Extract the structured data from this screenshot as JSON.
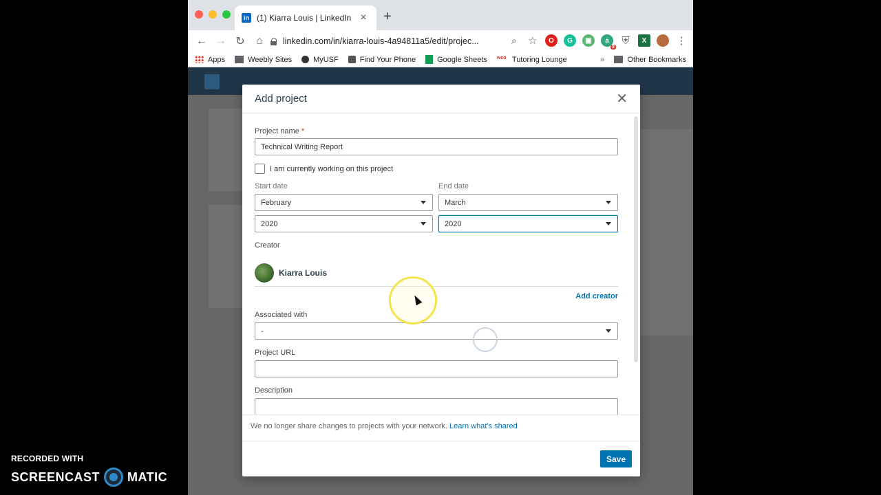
{
  "watermark": {
    "line1": "RECORDED WITH",
    "left": "SCREENCAST",
    "right": "MATIC"
  },
  "browser": {
    "tab_title": "(1) Kiarra Louis | LinkedIn",
    "tab_favicon": "in",
    "url": "linkedin.com/in/kiarra-louis-4a94811a5/edit/projec...",
    "bookmarks": [
      {
        "label": "Apps",
        "icon": "apps-grid-icon"
      },
      {
        "label": "Weebly Sites",
        "icon": "folder-icon"
      },
      {
        "label": "MyUSF",
        "icon": "usf-icon"
      },
      {
        "label": "Find Your Phone",
        "icon": "phone-icon"
      },
      {
        "label": "Google Sheets",
        "icon": "sheets-icon"
      },
      {
        "label": "Tutoring Lounge",
        "icon": "wco-icon"
      }
    ],
    "bookmarks_overflow": "»",
    "other_bookmarks": "Other Bookmarks",
    "extension_badge": "8"
  },
  "modal": {
    "title": "Add project",
    "project_name_label": "Project name",
    "required_mark": "*",
    "project_name_value": "Technical Writing Report",
    "currently_working_label": "I am currently working on this project",
    "start_date_label": "Start date",
    "end_date_label": "End date",
    "start_month": "February",
    "start_year": "2020",
    "end_month": "March",
    "end_year": "2020",
    "creator_label": "Creator",
    "creator_name": "Kiarra Louis",
    "add_creator": "Add creator",
    "associated_label": "Associated with",
    "associated_value": "-",
    "project_url_label": "Project URL",
    "project_url_value": "",
    "description_label": "Description",
    "footer_note": "We no longer share changes to projects with your network.",
    "footer_link": "Learn what's shared",
    "save": "Save"
  },
  "colors": {
    "accent": "#0073b1",
    "linkedin_header": "#1c3b55"
  }
}
